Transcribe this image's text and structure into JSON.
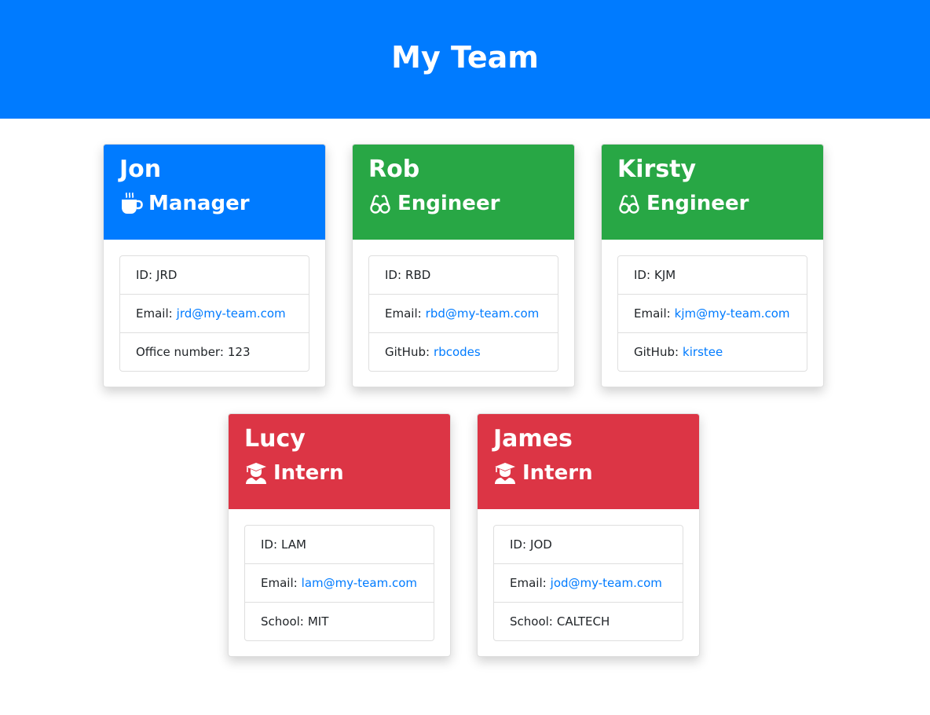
{
  "page": {
    "title": "My Team"
  },
  "colors": {
    "header": "#007bff",
    "manager": "#007bff",
    "engineer": "#28a745",
    "intern": "#dc3545",
    "link": "#007bff"
  },
  "cards": [
    {
      "name": "Jon",
      "role": "Manager",
      "icon": "coffee-icon",
      "id_label": "ID:",
      "id_value": "JRD",
      "email_label": "Email:",
      "email": "jrd@my-team.com",
      "extra_label": "Office number:",
      "extra_value": "123"
    },
    {
      "name": "Rob",
      "role": "Engineer",
      "icon": "glasses-icon",
      "id_label": "ID:",
      "id_value": "RBD",
      "email_label": "Email:",
      "email": "rbd@my-team.com",
      "extra_label": "GitHub:",
      "extra_value": "rbcodes"
    },
    {
      "name": "Kirsty",
      "role": "Engineer",
      "icon": "glasses-icon",
      "id_label": "ID:",
      "id_value": "KJM",
      "email_label": "Email:",
      "email": "kjm@my-team.com",
      "extra_label": "GitHub:",
      "extra_value": "kirstee"
    },
    {
      "name": "Lucy",
      "role": "Intern",
      "icon": "graduate-icon",
      "id_label": "ID:",
      "id_value": "LAM",
      "email_label": "Email:",
      "email": "lam@my-team.com",
      "extra_label": "School:",
      "extra_value": "MIT"
    },
    {
      "name": "James",
      "role": "Intern",
      "icon": "graduate-icon",
      "id_label": "ID:",
      "id_value": "JOD",
      "email_label": "Email:",
      "email": "jod@my-team.com",
      "extra_label": "School:",
      "extra_value": "CALTECH"
    }
  ]
}
